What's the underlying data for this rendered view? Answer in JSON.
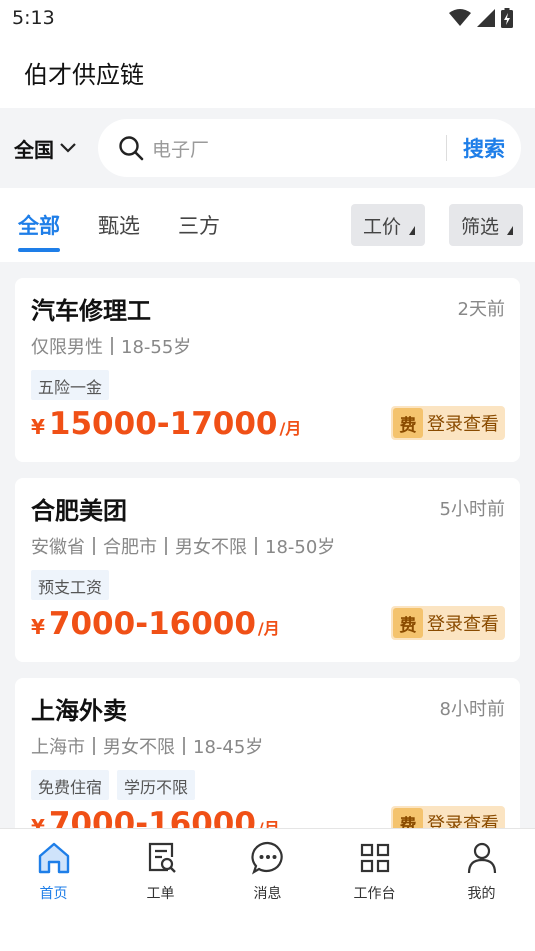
{
  "status": {
    "time": "5:13"
  },
  "app": {
    "title": "伯才供应链"
  },
  "search": {
    "region": "全国",
    "placeholder": "电子厂",
    "button": "搜索"
  },
  "tabs": [
    {
      "label": "全部",
      "active": true
    },
    {
      "label": "甄选",
      "active": false
    },
    {
      "label": "三方",
      "active": false
    }
  ],
  "filters": {
    "price": "工价",
    "filter": "筛选"
  },
  "jobs": [
    {
      "title": "汽车修理工",
      "time": "2天前",
      "meta": [
        "仅限男性",
        "18-55岁"
      ],
      "tags": [
        "五险一金"
      ],
      "currency": "¥",
      "salary": "15000-17000",
      "unit": "/月",
      "fee_badge": "费",
      "login_text": "登录查看"
    },
    {
      "title": "合肥美团",
      "time": "5小时前",
      "meta": [
        "安徽省",
        "合肥市",
        "男女不限",
        "18-50岁"
      ],
      "tags": [
        "预支工资"
      ],
      "currency": "¥",
      "salary": "7000-16000",
      "unit": "/月",
      "fee_badge": "费",
      "login_text": "登录查看"
    },
    {
      "title": "上海外卖",
      "time": "8小时前",
      "meta": [
        "上海市",
        "男女不限",
        "18-45岁"
      ],
      "tags": [
        "免费住宿",
        "学历不限"
      ],
      "currency": "¥",
      "salary": "7000-16000",
      "unit": "/月",
      "fee_badge": "费",
      "login_text": "登录查看"
    }
  ],
  "nav": [
    {
      "label": "首页",
      "icon": "home-icon",
      "active": true
    },
    {
      "label": "工单",
      "icon": "work-order-icon",
      "active": false
    },
    {
      "label": "消息",
      "icon": "message-icon",
      "active": false
    },
    {
      "label": "工作台",
      "icon": "grid-icon",
      "active": false
    },
    {
      "label": "我的",
      "icon": "user-icon",
      "active": false
    }
  ],
  "colors": {
    "accent": "#1e7ee8",
    "salary": "#f05016",
    "fee_bg": "#fbe4c2"
  }
}
